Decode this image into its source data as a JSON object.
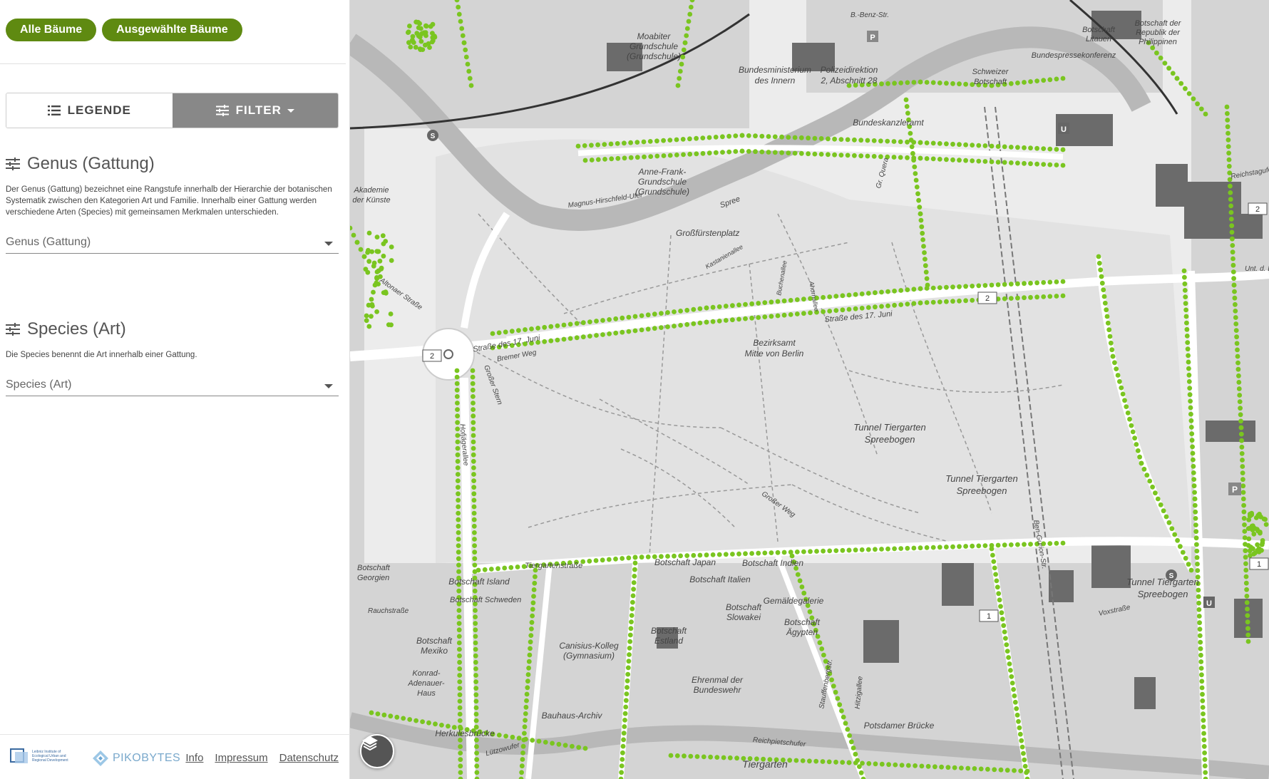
{
  "top_buttons": {
    "all_trees": "Alle Bäume",
    "selected_trees": "Ausgewählte Bäume"
  },
  "tabs": {
    "legend": "LEGENDE",
    "filter": "FILTER"
  },
  "genus": {
    "title": "Genus (Gattung)",
    "description": "Der Genus (Gattung) bezeichnet eine Rangstufe innerhalb der Hierarchie der botanischen Systematik zwischen den Kategorien Art und Familie. Innerhalb einer Gattung werden verschiedene Arten (Species) mit gemeinsamen Merkmalen unterschieden.",
    "select_value": "Genus (Gattung)"
  },
  "species": {
    "title": "Species (Art)",
    "description": "Die Species benennt die Art innerhalb einer Gattung.",
    "select_value": "Species (Art)"
  },
  "footer": {
    "ioer_logo_text": "Leibniz Institute of Ecological Urban and Regional Development",
    "pikobytes": "PIKOBYTES",
    "links": [
      "Info",
      "Impressum",
      "Datenschutz"
    ]
  },
  "map": {
    "tree_color": "#7ac520",
    "route_numbers": [
      "2",
      "2",
      "1",
      "2",
      "1"
    ],
    "labels": {
      "grossfuerstenplatz": "Großfürstenplatz",
      "strasse_17_juni": "Straße des 17. Juni",
      "strasse_17_juni_right": "Straße des 17. Juni",
      "bremer_weg": "Bremer Weg",
      "bezirksamt": "Bezirksamt",
      "mitte_von_berlin": "Mitte von Berlin",
      "tunnel_a": "Tunnel Tiergarten",
      "spreebogen_a": "Spreebogen",
      "tunnel_b": "Tunnel Tiergarten",
      "spreebogen_b": "Spreebogen",
      "tunnel_c": "Tunnel Tiergarten",
      "spreebogen_c": "Spreebogen",
      "tiergartenstrasse": "Tiergartenstraße",
      "bundeskanzleramt": "Bundeskanzleramt",
      "bundesministerium": "Bundesministerium",
      "des_innern": "des Innern",
      "polizeidirektion": "Polizeidirektion",
      "abschnitt": "2, Abschnitt 28",
      "moabiter": "Moabiter",
      "grundschule": "Grundschule",
      "grundschule_paren": "(Grundschule)",
      "anne_frank": "Anne-Frank-",
      "anne_grundschule": "Grundschule",
      "anne_paren": "(Grundschule)",
      "schweizer": "Schweizer",
      "botschaft_ch": "Botschaft",
      "akademie": "Akademie",
      "der_kuenste": "der Künste",
      "botschaft_japan": "Botschaft Japan",
      "botschaft_indien": "Botschaft Indien",
      "botschaft_italien": "Botschaft Italien",
      "botschaft_island": "Botschaft Island",
      "botschaft_slowakei_1": "Botschaft",
      "botschaft_slowakei_2": "Slowakei",
      "botschaft_estland_1": "Botschaft",
      "botschaft_estland_2": "Estland",
      "botschaft_aegypten_1": "Botschaft",
      "botschaft_aegypten_2": "Ägypten",
      "botschaft_mexiko_1": "Botschaft",
      "botschaft_mexiko_2": "Mexiko",
      "gemaeldegalerie": "Gemäldegalerie",
      "canisius_1": "Canisius-Kolleg",
      "canisius_2": "(Gymnasium)",
      "ehrenmal_1": "Ehrenmal der",
      "ehrenmal_2": "Bundeswehr",
      "bauhaus": "Bauhaus-Archiv",
      "herkulesbruecke": "Herkulesbrücke",
      "potsdamer_bruecke": "Potsdamer Brücke",
      "tiergarten": "Tiergarten",
      "konrad_1": "Konrad-",
      "konrad_2": "Adenauer-",
      "konrad_3": "Haus",
      "magnus": "Magnus-Hirschfeld-Ufer",
      "grosser_weg": "Großer Weg",
      "grosser_stern": "Großer Stern",
      "spree": "Spree",
      "bundespressekonferenz": "Bundespressekonferenz",
      "botschaft_litauen_1": "Botschaft",
      "botschaft_litauen_2": "Litauen",
      "botschaft_phil_1": "Botschaft der",
      "botschaft_phil_2": "Republik der",
      "botschaft_phil_3": "Philippinen",
      "hofjaegerallee": "Hofjägerallee",
      "altonaer": "Altonaer Straße",
      "raucherstrasse": "Rauchstraße",
      "reichpietschufer": "Reichpietschufer",
      "luetzowufer": "Lützowufer",
      "kastanienallee": "Kastanienallee",
      "fuchsallee": "Fuchsallee",
      "buchenallee": "Buchenallee",
      "ahornallee": "Ahornallee",
      "stauffenbergstr": "Stauffenbergstr.",
      "hitzigallee": "Hitzigallee",
      "boelcke": "B.-Benz-Str.",
      "voxstrasse": "Voxstraße",
      "ben_gurion": "Ben-Gurion-Str.",
      "unt_d_l": "Unt. d. L.",
      "reichstagufer": "Reichstagufer",
      "gr_quera": "Gr. Quera",
      "georgien_1": "Botschaft",
      "georgien_2": "Georgien",
      "schweiz_b": "Botschaft Schweden"
    }
  }
}
